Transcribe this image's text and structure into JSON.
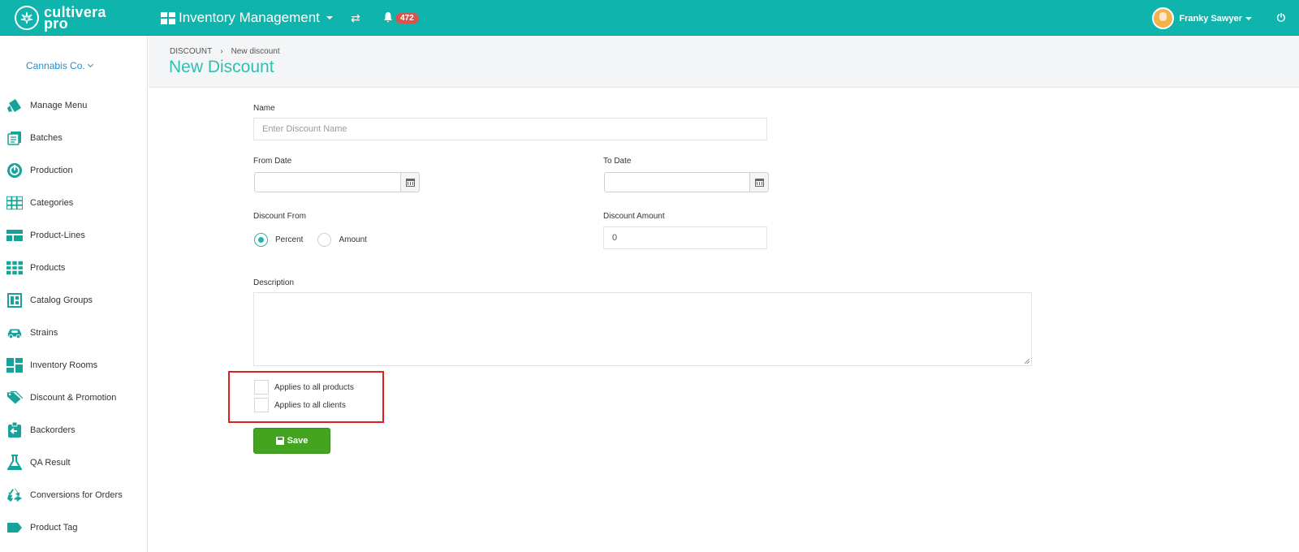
{
  "topbar": {
    "logo_line1": "cultivera",
    "logo_line2": "pro",
    "app_title": "Inventory Management",
    "notifications_count": "472",
    "user_name": "Franky Sawyer"
  },
  "sidebar": {
    "company": "Cannabis Co.",
    "items": [
      {
        "label": "Manage Menu",
        "icon": "menu-tag-icon"
      },
      {
        "label": "Batches",
        "icon": "batches-icon"
      },
      {
        "label": "Production",
        "icon": "production-icon"
      },
      {
        "label": "Categories",
        "icon": "categories-grid-icon"
      },
      {
        "label": "Product-Lines",
        "icon": "product-lines-icon"
      },
      {
        "label": "Products",
        "icon": "products-grid-icon"
      },
      {
        "label": "Catalog Groups",
        "icon": "catalog-groups-icon"
      },
      {
        "label": "Strains",
        "icon": "strains-icon"
      },
      {
        "label": "Inventory Rooms",
        "icon": "inventory-rooms-icon"
      },
      {
        "label": "Discount & Promotion",
        "icon": "discount-tag-icon"
      },
      {
        "label": "Backorders",
        "icon": "backorders-icon"
      },
      {
        "label": "QA Result",
        "icon": "flask-icon"
      },
      {
        "label": "Conversions for Orders",
        "icon": "recycle-icon"
      },
      {
        "label": "Product Tag",
        "icon": "tag-icon"
      }
    ]
  },
  "header": {
    "breadcrumb_parent": "DISCOUNT",
    "breadcrumb_current": "New discount",
    "title": "New Discount"
  },
  "form": {
    "name_label": "Name",
    "name_placeholder": "Enter Discount Name",
    "from_date_label": "From Date",
    "from_date_value": "",
    "to_date_label": "To Date",
    "to_date_value": "",
    "discount_from_label": "Discount From",
    "option_percent": "Percent",
    "option_amount": "Amount",
    "selected_option": "Percent",
    "discount_amount_label": "Discount Amount",
    "discount_amount_value": "0",
    "description_label": "Description",
    "description_value": "",
    "applies_products": "Applies to all products",
    "applies_clients": "Applies to all clients",
    "save_label": "Save"
  },
  "colors": {
    "brand_teal": "#0fb5ad",
    "title_teal": "#2fbfb3",
    "save_green": "#43a51f",
    "badge_red": "#d9534f",
    "highlight_red": "#e02020"
  }
}
